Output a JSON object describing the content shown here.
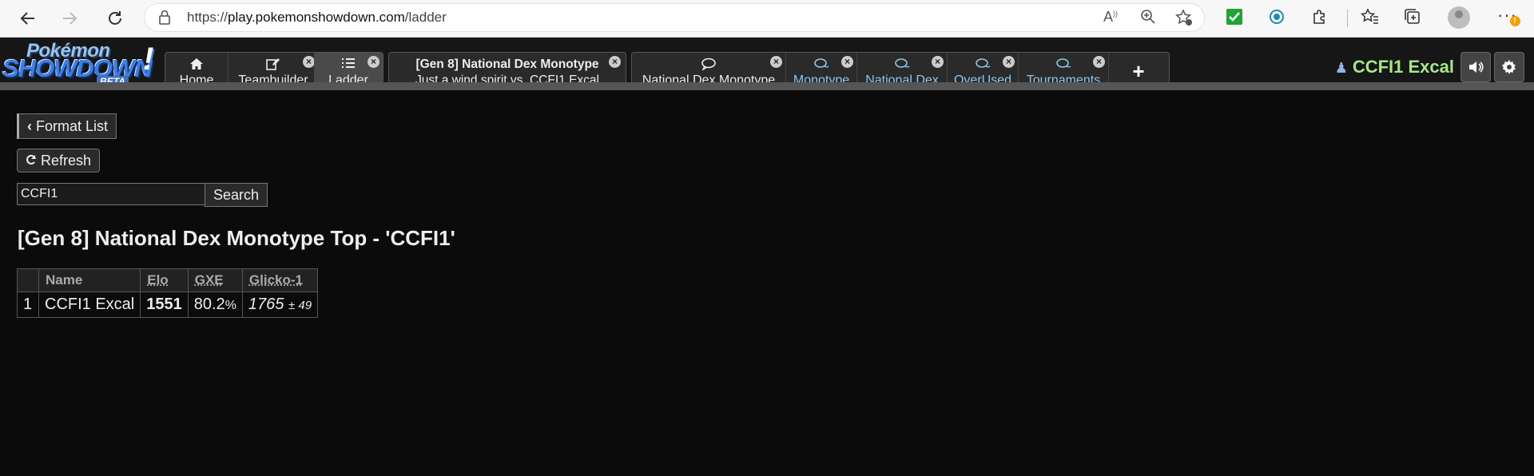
{
  "browser": {
    "url_prefix": "https://",
    "url_host": "play.pokemonshowdown.com",
    "url_path": "/ladder",
    "notification_count": "!"
  },
  "logo": {
    "line1": "Pokémon",
    "line2": "SHOWDOWN",
    "line3": "BETA",
    "bang": "!"
  },
  "tabs": {
    "home": "Home",
    "teambuilder": "Teambuilder",
    "ladder": "Ladder",
    "battle_line1": "[Gen 8] National Dex Monotype",
    "battle_line2": "Just a wind spirit vs. CCFI1 Excal",
    "rooms": [
      "National Dex Monotype",
      "Monotype",
      "National Dex",
      "OverUsed",
      "Tournaments"
    ],
    "close_glyph": "×",
    "plus": "+"
  },
  "user": {
    "name": "CCFI1 Excal"
  },
  "page": {
    "format_list": "Format List",
    "refresh": "Refresh",
    "search_value": "CCFI1",
    "search_button": "Search",
    "heading": "[Gen 8] National Dex Monotype Top - 'CCFI1'"
  },
  "table": {
    "headers": [
      "",
      "Name",
      "Elo",
      "GXE",
      "Glicko-1"
    ],
    "rows": [
      {
        "rank": "1",
        "name": "CCFI1 Excal",
        "elo": "1551",
        "gxe": "80.2",
        "gxe_unit": "%",
        "glicko": "1765",
        "glicko_dev": "± 49"
      }
    ]
  },
  "colors": {
    "username": "#a7e68a",
    "room_tab_text": "#8fc6ee",
    "background": "#0b0b0b"
  }
}
